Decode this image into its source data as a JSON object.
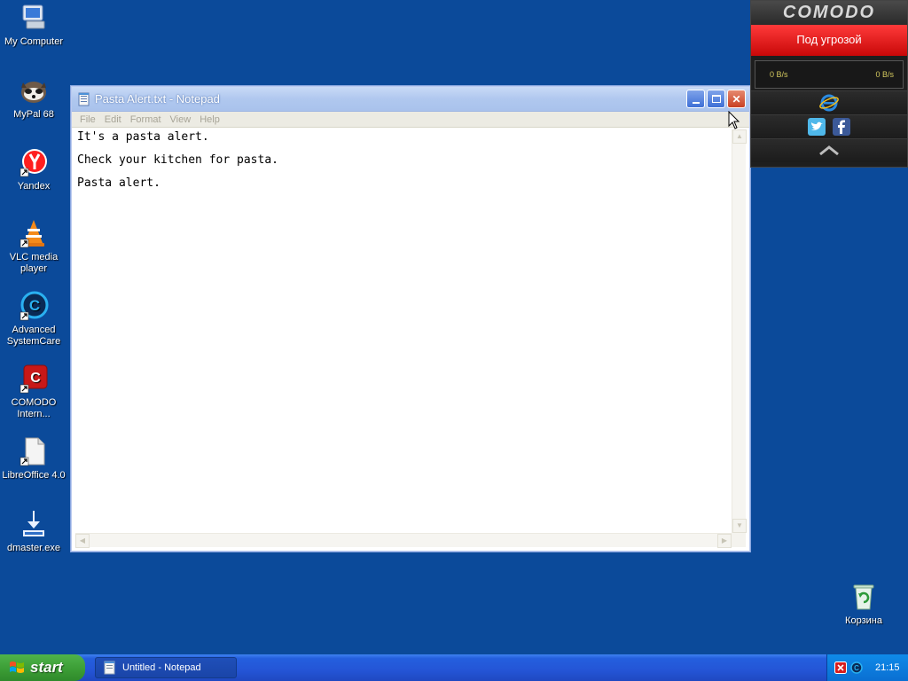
{
  "desktop": {
    "icons": [
      {
        "label": "My Computer",
        "name": "my-computer-icon"
      },
      {
        "label": "MyPal 68",
        "name": "mypal-icon"
      },
      {
        "label": "Yandex",
        "name": "yandex-icon"
      },
      {
        "label": "VLC media player",
        "name": "vlc-icon"
      },
      {
        "label": "Advanced SystemCare",
        "name": "advanced-systemcare-icon"
      },
      {
        "label": "COMODO Intern...",
        "name": "comodo-internet-security-icon"
      },
      {
        "label": "LibreOffice 4.0",
        "name": "libreoffice-icon"
      },
      {
        "label": "dmaster.exe",
        "name": "download-icon"
      }
    ],
    "recycle_bin": {
      "label": "Корзина",
      "name": "recycle-bin-icon"
    }
  },
  "notepad": {
    "title": "Pasta Alert.txt - Notepad",
    "menu": [
      "File",
      "Edit",
      "Format",
      "View",
      "Help"
    ],
    "lines": [
      "It's a pasta alert.",
      "Check your kitchen for pasta.",
      "Pasta alert."
    ]
  },
  "comodo_widget": {
    "logo": "COMODO",
    "status": "Под угрозой",
    "download_speed": "0 B/s",
    "upload_speed": "0 B/s",
    "status_color": "#e01010",
    "speed_color": "#d3c85e"
  },
  "taskbar": {
    "start_label": "start",
    "task_label": "Untitled - Notepad",
    "clock": "21:15"
  }
}
